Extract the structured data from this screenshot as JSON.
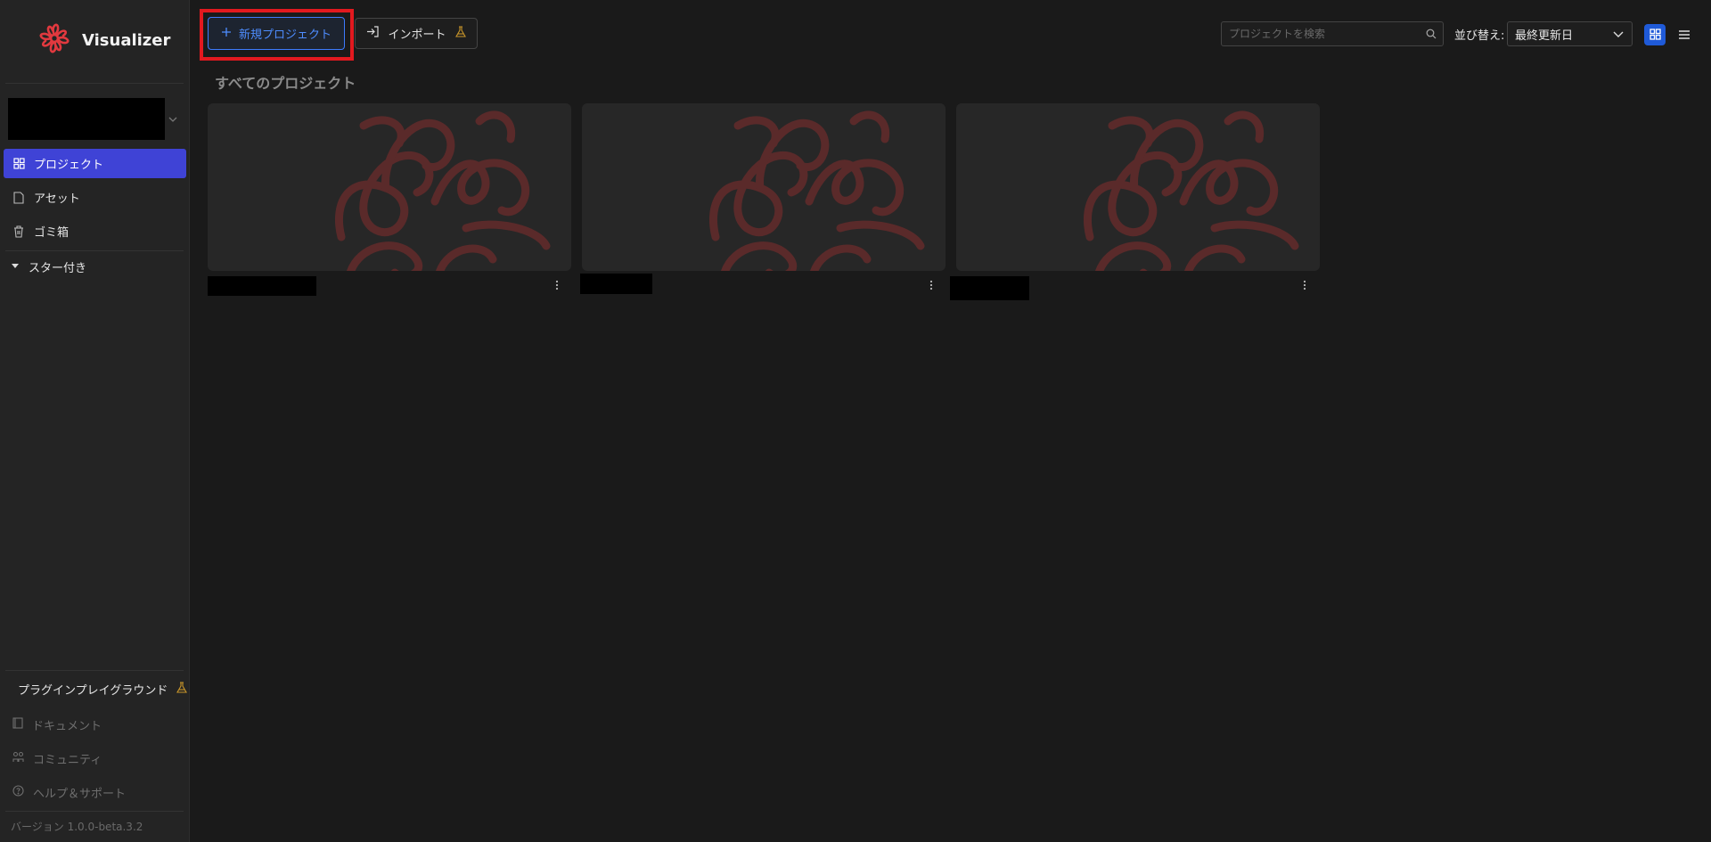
{
  "app": {
    "name": "Visualizer",
    "version": "バージョン 1.0.0-beta.3.2"
  },
  "sidebar": {
    "nav": [
      {
        "label": "プロジェクト",
        "icon": "grid-icon",
        "active": true
      },
      {
        "label": "アセット",
        "icon": "file-icon",
        "active": false
      },
      {
        "label": "ゴミ箱",
        "icon": "trash-icon",
        "active": false
      }
    ],
    "starred_label": "スター付き",
    "playground_label": "プラグインプレイグラウンド",
    "bottom": [
      {
        "label": "ドキュメント",
        "icon": "book-icon"
      },
      {
        "label": "コミュニティ",
        "icon": "community-icon"
      },
      {
        "label": "ヘルプ＆サポート",
        "icon": "help-icon"
      }
    ]
  },
  "toolbar": {
    "new_project_label": "新規プロジェクト",
    "import_label": "インポート",
    "search_placeholder": "プロジェクトを検索",
    "sort_label": "並び替え:",
    "sort_value": "最終更新日"
  },
  "main": {
    "section_title": "すべてのプロジェクト",
    "projects": [
      {
        "name": ""
      },
      {
        "name": ""
      },
      {
        "name": ""
      }
    ]
  },
  "colors": {
    "accent": "#3f43d6",
    "brand_red": "#e2191f",
    "new_button_blue": "#4e8dff",
    "experimental_gold": "#c9962a"
  }
}
